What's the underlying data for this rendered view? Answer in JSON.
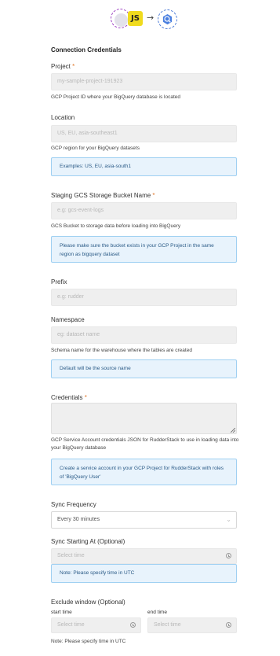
{
  "logos": {
    "source_icon": "javascript-icon",
    "source_badge": "JS",
    "arrow": "→",
    "destination_icon": "bigquery-icon"
  },
  "section_title": "Connection Credentials",
  "project": {
    "label": "Project",
    "required": "*",
    "placeholder": "my-sample-project-191923",
    "help": "GCP Project ID where your BigQuery database is located"
  },
  "location": {
    "label": "Location",
    "placeholder": "US, EU, asia-southeast1",
    "help": "GCP region for your BigQuery datasets",
    "note": "Examples: US, EU, asia-south1"
  },
  "bucket": {
    "label": "Staging GCS Storage Bucket Name",
    "required": "*",
    "placeholder": "e.g: gcs-event-logs",
    "help": "GCS Bucket to storage data before loading into BigQuery",
    "note": "Please make sure the bucket exists in your GCP Project in the same region as bigquery dataset"
  },
  "prefix": {
    "label": "Prefix",
    "placeholder": "e.g: rudder"
  },
  "namespace": {
    "label": "Namespace",
    "placeholder": "eg: dataset name",
    "help": "Schema name for the warehouse where the tables are created",
    "note": "Default will be the source name"
  },
  "credentials": {
    "label": "Credentials",
    "required": "*",
    "help": "GCP Service Account credentials JSON for RudderStack to use in loading data into your BigQuery database",
    "note": "Create a service account in your GCP Project for RudderStack with roles of 'BigQuery User'"
  },
  "sync_frequency": {
    "label": "Sync Frequency",
    "value": "Every 30 minutes"
  },
  "sync_start": {
    "label": "Sync Starting At (Optional)",
    "placeholder": "Select time",
    "note": "Note: Please specify time in UTC"
  },
  "exclude_window": {
    "label": "Exclude window (Optional)",
    "start_label": "start time",
    "end_label": "end time",
    "start_placeholder": "Select time",
    "end_placeholder": "Select time",
    "note": "Note: Please specify time in UTC"
  }
}
